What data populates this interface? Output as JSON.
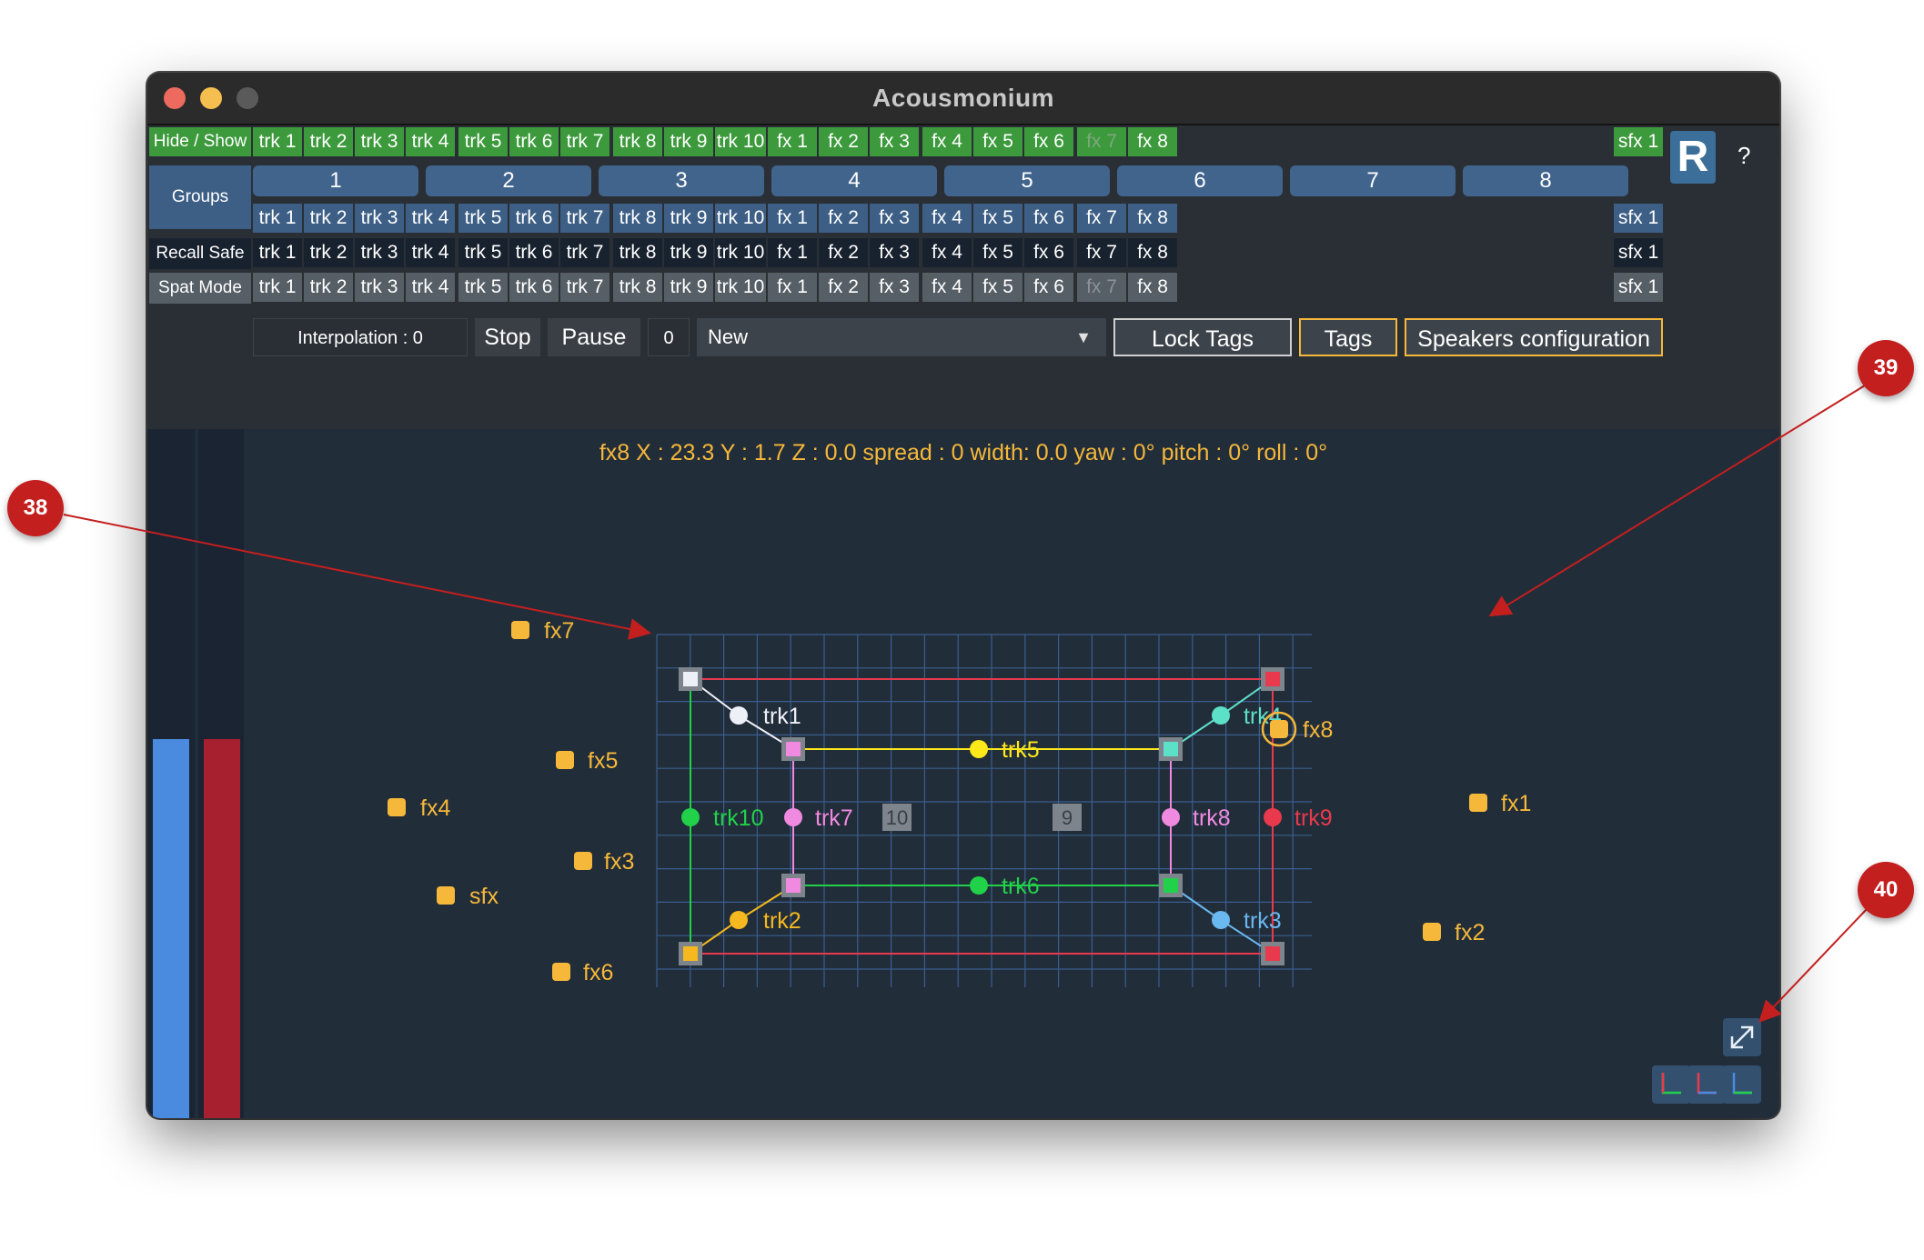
{
  "window": {
    "title": "Acousmonium"
  },
  "hide_show": {
    "label": "Hide / Show",
    "tracks": [
      "trk 1",
      "trk 2",
      "trk 3",
      "trk 4",
      "trk 5",
      "trk 6",
      "trk 7",
      "trk 8",
      "trk 9",
      "trk 10",
      "fx 1",
      "fx 2",
      "fx 3",
      "fx 4",
      "fx 5",
      "fx 6",
      "fx 7",
      "fx 8"
    ],
    "sfx": "sfx 1"
  },
  "groups": {
    "label": "Groups",
    "buttons": [
      "1",
      "2",
      "3",
      "4",
      "5",
      "6",
      "7",
      "8"
    ],
    "tracks": [
      "trk 1",
      "trk 2",
      "trk 3",
      "trk 4",
      "trk 5",
      "trk 6",
      "trk 7",
      "trk 8",
      "trk 9",
      "trk 10",
      "fx 1",
      "fx 2",
      "fx 3",
      "fx 4",
      "fx 5",
      "fx 6",
      "fx 7",
      "fx 8"
    ],
    "sfx": "sfx 1"
  },
  "recall_safe": {
    "label": "Recall Safe",
    "tracks": [
      "trk 1",
      "trk 2",
      "trk 3",
      "trk 4",
      "trk 5",
      "trk 6",
      "trk 7",
      "trk 8",
      "trk 9",
      "trk 10",
      "fx 1",
      "fx 2",
      "fx 3",
      "fx 4",
      "fx 5",
      "fx 6",
      "fx 7",
      "fx 8"
    ],
    "sfx": "sfx 1"
  },
  "spat_mode": {
    "label": "Spat Mode",
    "tracks": [
      "trk 1",
      "trk 2",
      "trk 3",
      "trk 4",
      "trk 5",
      "trk 6",
      "trk 7",
      "trk 8",
      "trk 9",
      "trk 10",
      "fx 1",
      "fx 2",
      "fx 3",
      "fx 4",
      "fx 5",
      "fx 6",
      "fx 7",
      "fx 8"
    ],
    "sfx": "sfx 1"
  },
  "controls": {
    "interpolation": "Interpolation : 0",
    "stop": "Stop",
    "pause": "Pause",
    "counter": "0",
    "preset": "New",
    "lock_tags": "Lock Tags",
    "tags": "Tags",
    "speakers_config": "Speakers configuration"
  },
  "logo": {
    "letter": "R"
  },
  "help": "?",
  "info_bar": "fx8   X : 23.3   Y : 1.7   Z : 0.0   spread : 0 width:  0.0   yaw : 0° pitch : 0° roll : 0°",
  "vu_levels": {
    "left": 0.51,
    "right": 0.51
  },
  "scene": {
    "colors": {
      "grid": "#3a5e8e",
      "yellow": "#f5b83a",
      "white": "#eef0f8",
      "pink": "#f08ae0",
      "green": "#21d14a",
      "red": "#e83a4c",
      "cyan": "#5de0c8",
      "blue": "#6ab8f0",
      "lime": "#ffe81a",
      "orange": "#f5b81f"
    },
    "tracks": {
      "trk1": "trk1",
      "trk2": "trk2",
      "trk3": "trk3",
      "trk4": "trk4",
      "trk5": "trk5",
      "trk6": "trk6",
      "trk7": "trk7",
      "trk8": "trk8",
      "trk9": "trk9",
      "trk10": "trk10"
    },
    "fx": {
      "fx1": "fx1",
      "fx2": "fx2",
      "fx3": "fx3",
      "fx4": "fx4",
      "fx5": "fx5",
      "fx6": "fx6",
      "fx7": "fx7",
      "fx8": "fx8",
      "sfx": "sfx"
    },
    "speakers": {
      "s10": "10",
      "s9": "9"
    }
  },
  "callouts": {
    "c38": "38",
    "c39": "39",
    "c40": "40"
  },
  "icons": {
    "expand": "expand-icon",
    "axes": [
      "axes-xy-icon",
      "axes-xz-icon",
      "axes-yz-icon"
    ]
  }
}
